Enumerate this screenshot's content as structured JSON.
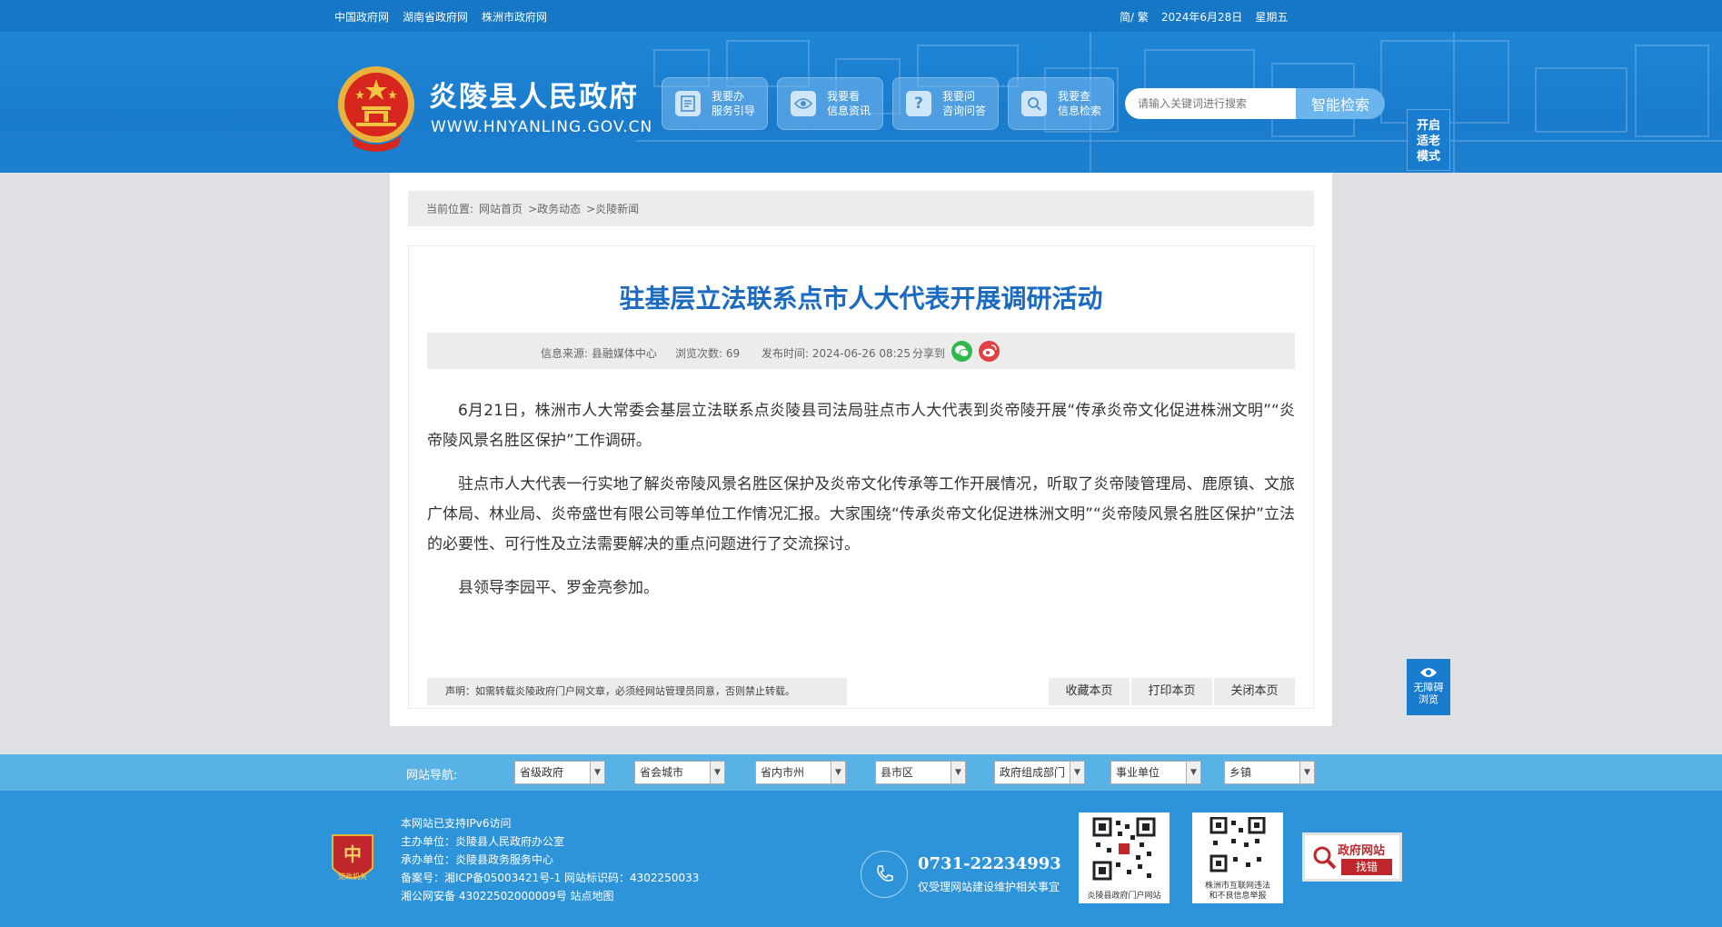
{
  "topbar": {
    "links": [
      "中国政府网",
      "湖南省政府网",
      "株洲市政府网"
    ],
    "lang": "简/ 繁",
    "date": "2024年6月28日",
    "weekday": "星期五"
  },
  "header": {
    "site_name": "炎陵县人民政府",
    "site_url": "WWW.HNYANLING.GOV.CN",
    "nav": [
      {
        "line1": "我要办",
        "line2": "服务引导",
        "icon": "document-icon"
      },
      {
        "line1": "我要看",
        "line2": "信息资讯",
        "icon": "eye-icon"
      },
      {
        "line1": "我要问",
        "line2": "咨询问答",
        "icon": "question-icon"
      },
      {
        "line1": "我要查",
        "line2": "信息检索",
        "icon": "search-icon"
      }
    ],
    "search_placeholder": "请输入关键词进行搜索",
    "search_button": "智能检索",
    "elder_mode": [
      "开启",
      "适老",
      "模式"
    ]
  },
  "breadcrumb": {
    "prefix": "当前位置:",
    "items": [
      "网站首页",
      ">政务动态",
      ">炎陵新闻"
    ]
  },
  "article": {
    "title": "驻基层立法联系点市人大代表开展调研活动",
    "source": "信息来源: 县融媒体中心",
    "views": "浏览次数: 69",
    "published": "发布时间: 2024-06-26 08:25",
    "share_label": "分享到",
    "paragraphs": [
      "6月21日，株洲市人大常委会基层立法联系点炎陵县司法局驻点市人大代表到炎帝陵开展“传承炎帝文化促进株洲文明”“炎帝陵风景名胜区保护”工作调研。",
      "驻点市人大代表一行实地了解炎帝陵风景名胜区保护及炎帝文化传承等工作开展情况，听取了炎帝陵管理局、鹿原镇、文旅广体局、林业局、炎帝盛世有限公司等单位工作情况汇报。大家围绕“传承炎帝文化促进株洲文明”“炎帝陵风景名胜区保护”立法的必要性、可行性及立法需要解决的重点问题进行了交流探讨。",
      "县领导李园平、罗金亮参加。"
    ],
    "notice": "声明：如需转载炎陵政府门户网文章，必须经网站管理员同意，否则禁止转载。",
    "actions": [
      "收藏本页",
      "打印本页",
      "关闭本页"
    ]
  },
  "accessibility": [
    "无障碍",
    "浏览"
  ],
  "site_nav": {
    "label": "网站导航:",
    "selects": [
      "省级政府",
      "省会城市",
      "省内市州",
      "县市区",
      "政府组成部门",
      "事业单位",
      "乡镇"
    ]
  },
  "footer": {
    "lines": [
      "本网站已支持IPv6访问",
      "主办单位：炎陵县人民政府办公室",
      "承办单位：炎陵县政务服务中心",
      "备案号：湘ICP备05003421号-1 网站标识码：4302250033",
      "湘公网安备 43022502000009号 站点地图"
    ],
    "badge_text": "党政机关",
    "phone": "0731-22234993",
    "phone_note": "仅受理网站建设维护相关事宜",
    "qr1_caption": "炎陵县政府门户网站",
    "qr2_caption": [
      "株洲市互联网违法",
      "和不良信息举报"
    ],
    "error_box": {
      "line1": "政府网站",
      "line2": "找错"
    }
  },
  "colors": {
    "brand_blue": "#1677c6",
    "title_blue": "#1c6bc0",
    "footer_blue": "#2e94da",
    "nav_strip": "#58b2e6",
    "wechat_green": "#2fb84b",
    "weibo_red": "#e0403f"
  }
}
